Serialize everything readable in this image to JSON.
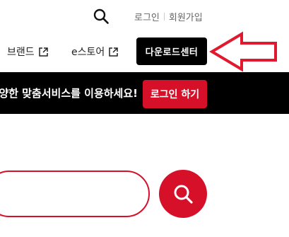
{
  "header": {
    "search_icon": "search-icon",
    "login_label": "로그인",
    "signup_label": "회원가입"
  },
  "nav": {
    "brand_label": "브랜드",
    "estore_label": "e스토어",
    "external_icon": "external-link-icon",
    "download_center_label": "다운로드센터"
  },
  "annotation": {
    "arrow_color": "#e0192e"
  },
  "banner": {
    "text": "양한 맞춤서비스를 이용하세요!",
    "login_button_label": "로그인 하기"
  },
  "search": {
    "placeholder": "",
    "button_icon": "search-icon"
  },
  "colors": {
    "brand_red": "#d7102a",
    "black": "#000000"
  }
}
